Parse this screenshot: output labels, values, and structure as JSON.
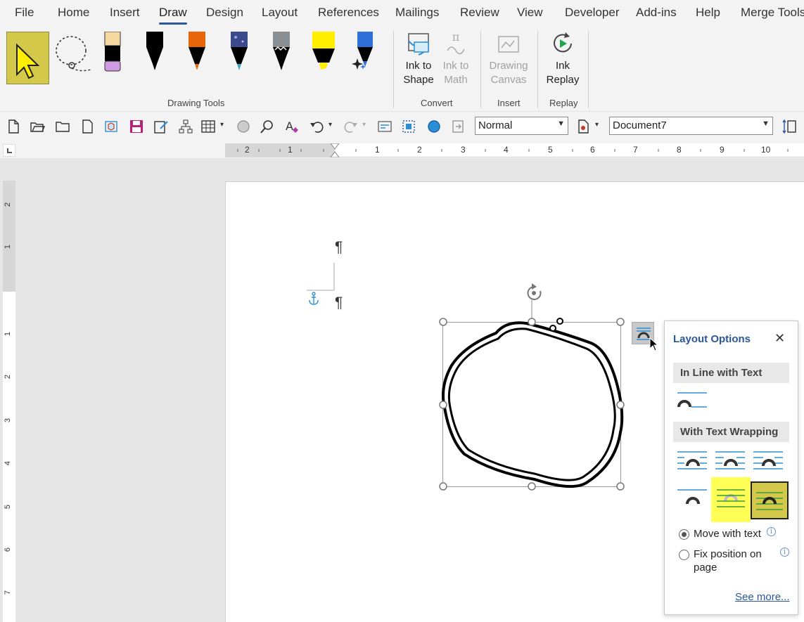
{
  "menu": {
    "items": [
      "File",
      "Home",
      "Insert",
      "Draw",
      "Design",
      "Layout",
      "References",
      "Mailings",
      "Review",
      "View",
      "Developer",
      "Add-ins",
      "Help",
      "Merge Tools"
    ],
    "active": "Draw"
  },
  "ribbon": {
    "groups": {
      "drawing_tools": "Drawing Tools",
      "convert": "Convert",
      "insert": "Insert",
      "replay": "Replay"
    },
    "buttons": {
      "ink_to_shape": [
        "Ink to",
        "Shape"
      ],
      "ink_to_math": [
        "Ink to",
        "Math"
      ],
      "drawing_canvas": [
        "Drawing",
        "Canvas"
      ],
      "ink_replay": [
        "Ink",
        "Replay"
      ]
    },
    "pens": [
      {
        "name": "select-tool",
        "color": "#d4c84a"
      },
      {
        "name": "lasso-tool",
        "color": "#333333"
      },
      {
        "name": "eraser",
        "color": "#f5d9a0"
      },
      {
        "name": "pen-black",
        "color": "#000000"
      },
      {
        "name": "pen-orange",
        "color": "#e8650a"
      },
      {
        "name": "pen-galaxy",
        "color": "#3a4a8a"
      },
      {
        "name": "pen-gray",
        "color": "#8a8f94"
      },
      {
        "name": "highlighter-yellow",
        "color": "#ffee00"
      },
      {
        "name": "pen-blue",
        "color": "#2f6fd8"
      }
    ]
  },
  "qat": {
    "style_value": "Normal",
    "document_value": "Document7"
  },
  "ruler": {
    "h_left": [
      "2",
      "1"
    ],
    "h_right": [
      "1",
      "2",
      "3",
      "4",
      "5",
      "6",
      "7",
      "8",
      "9",
      "10"
    ],
    "v_top": [
      "2",
      "1"
    ],
    "v_bottom": [
      "1",
      "2",
      "3",
      "4",
      "5",
      "6",
      "7"
    ]
  },
  "layout_options": {
    "title": "Layout Options",
    "close_symbol": "✕",
    "inline_heading": "In Line with Text",
    "wrapping_heading": "With Text Wrapping",
    "move_with_text": "Move with text",
    "fix_position": [
      "Fix position on",
      "page"
    ],
    "see_more": "See more...",
    "info_symbol": "i",
    "selected_option": "Move with text"
  },
  "colors": {
    "accent": "#2b579a",
    "highlight_yellow": "#ffff55",
    "selected_tile": "#d4c84a"
  }
}
